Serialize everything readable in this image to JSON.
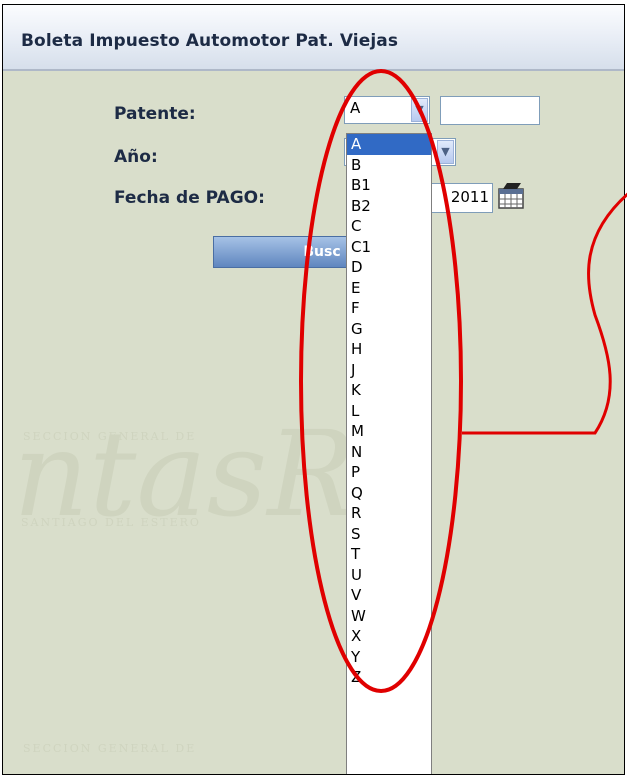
{
  "window": {
    "title": "Boleta Impuesto Automotor Pat. Viejas"
  },
  "watermark": {
    "big_text": "ntasRe",
    "small_line_1": "SECCION    GENERAL DE",
    "small_line_2": "SANTIAGO DEL ESTERO",
    "small_line_3": "SECCION    GENERAL DE"
  },
  "form": {
    "patente_label": "Patente:",
    "patente_select_value": "A",
    "patente_text_value": "",
    "anio_label": "Año:",
    "fecha_label": "Fecha de PAGO:",
    "fecha_value_visible": "2011",
    "search_button_label": "Busc"
  },
  "dropdown": {
    "selected": "A",
    "options": [
      "A",
      "B",
      "B1",
      "B2",
      "C",
      "C1",
      "D",
      "E",
      "F",
      "G",
      "H",
      "J",
      "K",
      "L",
      "M",
      "N",
      "P",
      "Q",
      "R",
      "S",
      "T",
      "U",
      "V",
      "W",
      "X",
      "Y",
      "Z"
    ]
  },
  "colors": {
    "annotation": "#e00000",
    "highlight": "#316ac5",
    "panel": "#d9decb"
  },
  "icons": {
    "dropdown_arrow": "chevron-down-icon",
    "calendar": "calendar-icon"
  }
}
